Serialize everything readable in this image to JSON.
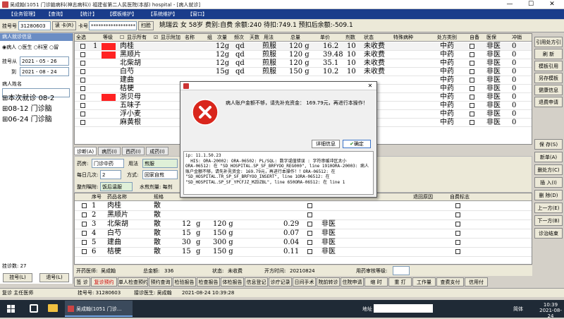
{
  "window": {
    "title": "吴成翰(1051 门诊脑病科(神志病科)) 福建省第二人民医院(本部) hospital - [病人就诊]",
    "min": "—",
    "max": "☐",
    "close": "✕"
  },
  "menu": [
    "【业务管理】",
    "【查询】",
    "【统计】",
    "【模板维护】",
    "【系统维护】",
    "【窗口】"
  ],
  "cardrow": {
    "card_no_label": "挂号号",
    "card_no": "31280603",
    "read_card": "读 卡(R)",
    "card_label": "卡号",
    "card_value": "******************",
    "scan": "扫脸",
    "patient": "姚瑞云  女  58岁  费别:自费  余额:240  待扣:749.1  预扣后余额:-509.1"
  },
  "left": {
    "header": "病人就诊信息",
    "r1": "病人",
    "r2": "医生",
    "r3": "科室",
    "r4": "留",
    "date1_label": "挂号从",
    "date1": "2021 - 05 - 26",
    "date2_label": "到",
    "date2": "2021 - 08 - 24",
    "name_label": "病人姓名",
    "tree": [
      "本次就诊 08-2",
      "08-12 门诊脑",
      "06-24 门诊脑"
    ],
    "count": "挂诊数: 27",
    "btn1": "挂号(L)",
    "btn2": "退号(L)"
  },
  "right": {
    "buttons": [
      "引用处方引",
      "刷 新",
      "模板引用",
      "另存模板",
      "健康信息",
      "退费申请",
      "保 存(S)",
      "新单(A)",
      "删处方(C)",
      "插 入(I)",
      "删 除(D)",
      "上一方(E)",
      "下一方(B)",
      "诊治结束"
    ]
  },
  "grid1": {
    "top_labels": {
      "all": "全选",
      "level": "等级",
      "show_all": "显示所有",
      "show_attach": "显示附加"
    },
    "headers": [
      "名称",
      "组",
      "次量",
      "频次",
      "天数",
      "用法",
      "总量",
      "单价",
      "剂数",
      "状态",
      "特殊病种",
      "处方类别",
      "自备",
      "医保",
      "冲销"
    ],
    "rows": [
      {
        "no": "1",
        "name": "肉桂",
        "dose": "12g",
        "freq": "qd",
        "usage": "煎服",
        "total": "120 g",
        "price": "16.2",
        "packs": "10",
        "status": "未收费",
        "cat": "中药",
        "ins": "非医",
        "x": "0"
      },
      {
        "no": "",
        "name": "黑顺片",
        "dose": "12g",
        "freq": "qd",
        "usage": "煎服",
        "total": "120 g",
        "price": "39.48",
        "packs": "10",
        "status": "未收费",
        "cat": "中药",
        "ins": "非医",
        "x": "0"
      },
      {
        "no": "",
        "name": "北柴胡",
        "dose": "12g",
        "freq": "qd",
        "usage": "煎服",
        "total": "120 g",
        "price": "35.1",
        "packs": "10",
        "status": "未收费",
        "cat": "中药",
        "ins": "非医",
        "x": "0"
      },
      {
        "no": "",
        "name": "白芍",
        "dose": "15g",
        "freq": "qd",
        "usage": "煎服",
        "total": "150 g",
        "price": "10.2",
        "packs": "10",
        "status": "未收费",
        "cat": "中药",
        "ins": "非医",
        "x": "0"
      },
      {
        "no": "",
        "name": "建曲",
        "dose": "",
        "freq": "",
        "usage": "",
        "total": "",
        "price": "",
        "packs": "",
        "status": "",
        "cat": "中药",
        "ins": "非医",
        "x": "0"
      },
      {
        "no": "",
        "name": "桔梗",
        "dose": "",
        "freq": "",
        "usage": "",
        "total": "",
        "price": "",
        "packs": "",
        "status": "",
        "cat": "中药",
        "ins": "非医",
        "x": "0"
      },
      {
        "no": "",
        "name": "浙贝母",
        "dose": "",
        "freq": "",
        "usage": "",
        "total": "",
        "price": "",
        "packs": "",
        "status": "",
        "cat": "中药",
        "ins": "非医",
        "x": "0"
      },
      {
        "no": "",
        "name": "五味子",
        "dose": "",
        "freq": "",
        "usage": "",
        "total": "",
        "price": "",
        "packs": "",
        "status": "",
        "cat": "中药",
        "ins": "非医",
        "x": "0"
      },
      {
        "no": "",
        "name": "浮小麦",
        "dose": "",
        "freq": "",
        "usage": "",
        "total": "",
        "price": "",
        "packs": "",
        "status": "",
        "cat": "中药",
        "ins": "非医",
        "x": "0"
      },
      {
        "no": "",
        "name": "麻黄根",
        "dose": "",
        "freq": "",
        "usage": "",
        "total": "",
        "price": "",
        "packs": "",
        "status": "",
        "cat": "中药",
        "ins": "非医",
        "x": "0"
      }
    ]
  },
  "tabs": [
    "诊断(A)",
    "病历(I)",
    "西药(I)",
    "成药(I)"
  ],
  "form": {
    "pharmacy_label": "药房:",
    "pharmacy": "门诊中药",
    "usage_label": "用法",
    "usage": "煎服",
    "per_day_label": "每日几次:",
    "per_day": "2",
    "method_label": "方式:",
    "method": "回家自煎",
    "packs_label": "整剂嘱附:",
    "packs": "饭后温服",
    "water_label": "水煎剂量: 每剂"
  },
  "grid2": {
    "headers": [
      "序号",
      "药品名称",
      "规格",
      "",
      "",
      "",
      "",
      "",
      "",
      "",
      "退回原因",
      "自费标志"
    ],
    "rows": [
      {
        "no": "1",
        "name": "肉桂",
        "spec": "散",
        "dose": "",
        "unit": "",
        "total": "",
        "price": "",
        "ins": ""
      },
      {
        "no": "2",
        "name": "黑顺片",
        "spec": "散",
        "dose": "",
        "unit": "",
        "total": "",
        "price": "",
        "ins": ""
      },
      {
        "no": "3",
        "name": "北柴胡",
        "spec": "散",
        "dose": "12",
        "unit": "g",
        "total": "120 g",
        "price": "0.29",
        "ins": "非医"
      },
      {
        "no": "4",
        "name": "白芍",
        "spec": "散",
        "dose": "15",
        "unit": "g",
        "total": "150 g",
        "price": "0.07",
        "ins": "非医"
      },
      {
        "no": "5",
        "name": "建曲",
        "spec": "散",
        "dose": "30",
        "unit": "g",
        "total": "300 g",
        "price": "0.04",
        "ins": "非医"
      },
      {
        "no": "6",
        "name": "桔梗",
        "spec": "散",
        "dose": "15",
        "unit": "g",
        "total": "150 g",
        "price": "0.11",
        "ins": "非医"
      }
    ]
  },
  "sum": {
    "doctor_label": "开药医师:",
    "doctor": "吴成翰",
    "total_label": "总金额:",
    "total": "336",
    "status_label": "状态:",
    "status": "未收费",
    "time_label": "开方时间:",
    "time": "20210824",
    "level_label": "用药审核等级:"
  },
  "bottombar": [
    "签 诊",
    "复诊预约",
    "单人检查预约",
    "预约查询",
    "检验报告",
    "检查报告",
    "体检报告",
    "信息登记",
    "诊疗记录",
    "日间手术",
    "院前转诊",
    "住院申请",
    "缩 时",
    "重 打",
    "工作量",
    "查费支付",
    "信用付"
  ],
  "status": {
    "s1": "复诊 主任医师",
    "s2": "挂号号: 31280603",
    "s3": "接诊医生: 吴成翰",
    "s4": "2021-08-24 10:39:28"
  },
  "dialog": {
    "title": "",
    "message": "病人账户金额不够，请先补充资金：  169.79元，再进行本操作！",
    "detail_btn": "详细信息",
    "ok_btn": "确定",
    "detail": "ip: 11.1.50.23\n  HIS: ORA-20002: ORA-06502: PL/SQL: 数字或值错误 : 字符串缓冲区太小\nORA-06512: 在 \"SD_HOSPITAL.SP_SF_BRFYOO_REG000\", line 1910ORA-20003: 病人账户金额不够，请先补充资金: 169.79元，再进行本操作！！ORA-06512: 在 \"SD_HOSPITAL.TR_SP_SF_BRFYOO_INSERT\", line 1ORA-06512: 在 \"SD_HOSPITAL.SP_SF_YPCFJZ_MZDZBL\", line 650ORA-06512: 在 line 1"
  },
  "taskbar": {
    "app": "吴成翰(1051 门诊...",
    "addr": "地址",
    "lang": "简体",
    "time": "10:39",
    "date": "2021-08-24"
  }
}
